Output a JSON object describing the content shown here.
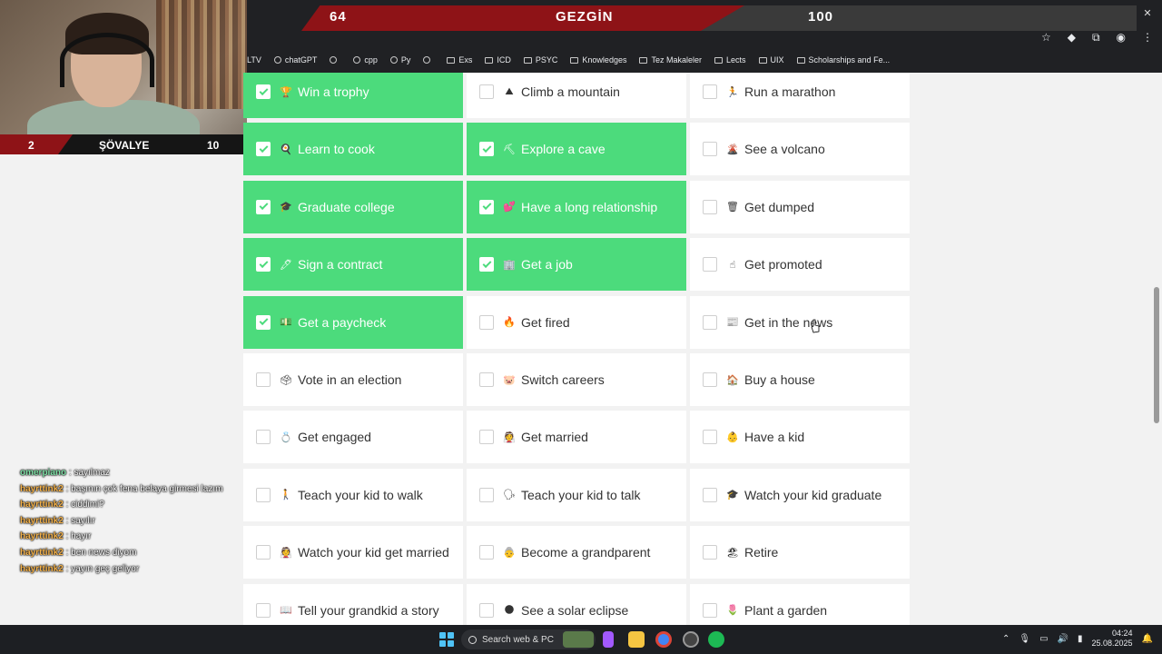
{
  "banner": {
    "left_value": "64",
    "title": "GEZGİN",
    "right_value": "100"
  },
  "webcam": {
    "left_value": "2",
    "title": "ŞÖVALYE",
    "right_value": "10"
  },
  "bookmarks": [
    {
      "label": "LTV",
      "icon": "none"
    },
    {
      "label": "chatGPT",
      "icon": "chatgpt-icon"
    },
    {
      "label": "",
      "icon": "grid-icon"
    },
    {
      "label": "cpp",
      "icon": "cpp-icon"
    },
    {
      "label": "Py",
      "icon": "python-icon"
    },
    {
      "label": "",
      "icon": "skull-icon"
    },
    {
      "label": "Exs",
      "icon": "folder-icon"
    },
    {
      "label": "ICD",
      "icon": "folder-icon"
    },
    {
      "label": "PSYC",
      "icon": "folder-icon"
    },
    {
      "label": "Knowledges",
      "icon": "folder-icon"
    },
    {
      "label": "Tez Makaleler",
      "icon": "folder-icon"
    },
    {
      "label": "Lects",
      "icon": "folder-icon"
    },
    {
      "label": "UIX",
      "icon": "folder-icon"
    },
    {
      "label": "Scholarships and Fe...",
      "icon": "folder-icon"
    }
  ],
  "grid": {
    "items": [
      {
        "label": "Win a trophy",
        "emoji": "🏆",
        "checked": true
      },
      {
        "label": "Climb a mountain",
        "emoji": "⛰",
        "checked": false
      },
      {
        "label": "Run a marathon",
        "emoji": "🏃",
        "checked": false
      },
      {
        "label": "Learn to cook",
        "emoji": "🍳",
        "checked": true
      },
      {
        "label": "Explore a cave",
        "emoji": "⛏",
        "checked": true
      },
      {
        "label": "See a volcano",
        "emoji": "🌋",
        "checked": false
      },
      {
        "label": "Graduate college",
        "emoji": "🎓",
        "checked": true
      },
      {
        "label": "Have a long relationship",
        "emoji": "💕",
        "checked": true
      },
      {
        "label": "Get dumped",
        "emoji": "🗑",
        "checked": false
      },
      {
        "label": "Sign a contract",
        "emoji": "🖊",
        "checked": true
      },
      {
        "label": "Get a job",
        "emoji": "🏢",
        "checked": true
      },
      {
        "label": "Get promoted",
        "emoji": "☝",
        "checked": false
      },
      {
        "label": "Get a paycheck",
        "emoji": "💵",
        "checked": true
      },
      {
        "label": "Get fired",
        "emoji": "🔥",
        "checked": false
      },
      {
        "label": "Get in the news",
        "emoji": "📰",
        "checked": false
      },
      {
        "label": "Vote in an election",
        "emoji": "🗳",
        "checked": false
      },
      {
        "label": "Switch careers",
        "emoji": "🐷",
        "checked": false
      },
      {
        "label": "Buy a house",
        "emoji": "🏠",
        "checked": false
      },
      {
        "label": "Get engaged",
        "emoji": "💍",
        "checked": false
      },
      {
        "label": "Get married",
        "emoji": "👰",
        "checked": false
      },
      {
        "label": "Have a kid",
        "emoji": "👶",
        "checked": false
      },
      {
        "label": "Teach your kid to walk",
        "emoji": "🚶",
        "checked": false
      },
      {
        "label": "Teach your kid to talk",
        "emoji": "🗣",
        "checked": false
      },
      {
        "label": "Watch your kid graduate",
        "emoji": "🎓",
        "checked": false
      },
      {
        "label": "Watch your kid get married",
        "emoji": "👰",
        "checked": false
      },
      {
        "label": "Become a grandparent",
        "emoji": "👵",
        "checked": false
      },
      {
        "label": "Retire",
        "emoji": "🏖",
        "checked": false
      },
      {
        "label": "Tell your grandkid a story",
        "emoji": "📖",
        "checked": false
      },
      {
        "label": "See a solar eclipse",
        "emoji": "🌑",
        "checked": false
      },
      {
        "label": "Plant a garden",
        "emoji": "🌷",
        "checked": false
      }
    ]
  },
  "chat": [
    {
      "user": "omerpiano",
      "message": ": sayılmaz",
      "alt": true
    },
    {
      "user": "hayrttink2",
      "message": ": başının çok fena belaya girmesi lazım",
      "alt": false
    },
    {
      "user": "hayrttink2",
      "message": ": ciddimi?",
      "alt": false
    },
    {
      "user": "hayrttink2",
      "message": ": sayılır",
      "alt": false
    },
    {
      "user": "hayrttink2",
      "message": ": hayır",
      "alt": false
    },
    {
      "user": "hayrttink2",
      "message": ": ben news diyom",
      "alt": false
    },
    {
      "user": "hayrttink2",
      "message": ": yayın geç geliyor",
      "alt": false
    }
  ],
  "taskbar": {
    "search_placeholder": "Search web & PC",
    "time": "04:24",
    "date": "25.08.2025"
  },
  "colors": {
    "checked_bg": "#4cdb7c",
    "banner_red": "#8e1317",
    "taskbar_bg": "#1d1f23"
  }
}
